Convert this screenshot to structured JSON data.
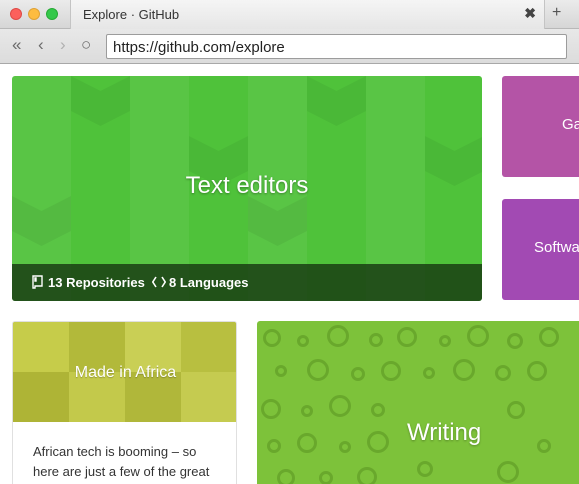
{
  "window": {
    "tab_title": "Explore · GitHub",
    "tab_close": "✖",
    "new_tab": "+"
  },
  "toolbar": {
    "back_all": "«",
    "back": "‹",
    "forward": "›",
    "reload": "○",
    "url": "https://github.com/explore"
  },
  "cards": {
    "text_editors": {
      "title": "Text editors",
      "repos": "13 Repositories",
      "languages": "8 Languages",
      "color": "#4fc23a"
    },
    "pink_card": {
      "label": "Ga",
      "color": "#b454a6"
    },
    "purple_card": {
      "label": "Softwa",
      "color": "#a24ab3"
    },
    "made_in_africa": {
      "title": "Made in Africa",
      "description": "African tech is booming – so here are just a few of the great",
      "color": "#bcc43f"
    },
    "writing": {
      "title": "Writing",
      "color": "#7dc23a"
    }
  },
  "icons": {
    "repo": "repo-icon",
    "code": "code-icon"
  }
}
